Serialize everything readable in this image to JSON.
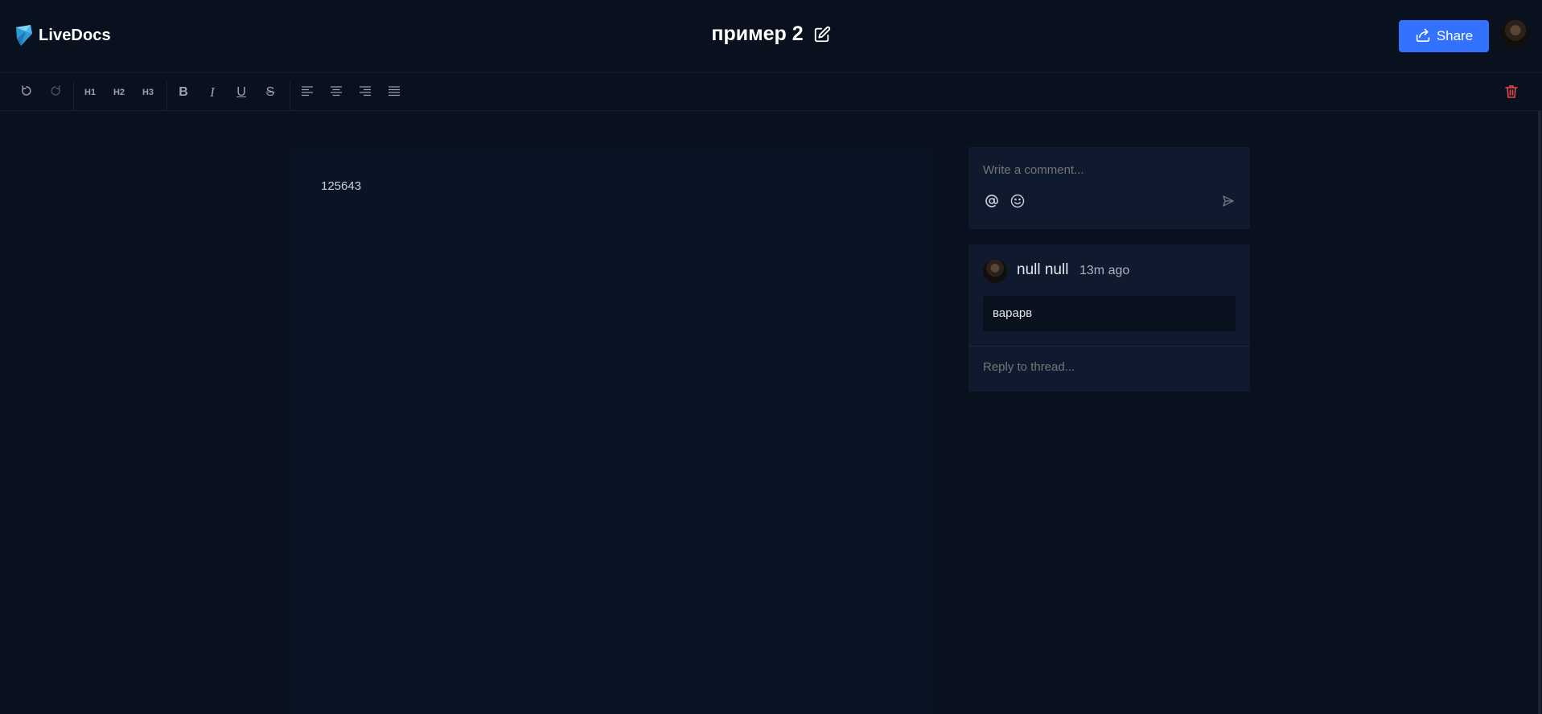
{
  "app": {
    "name": "LiveDocs"
  },
  "document": {
    "title": "пример 2",
    "content": "125643"
  },
  "header": {
    "share_label": "Share"
  },
  "comments": {
    "placeholder": "Write a comment...",
    "thread": {
      "author": "null null",
      "time": "13m ago",
      "message": "варарв",
      "reply_placeholder": "Reply to thread..."
    }
  },
  "toolbar": {
    "h1": "H1",
    "h2": "H2",
    "h3": "H3",
    "bold": "B",
    "italic": "I",
    "underline": "U",
    "strike": "S"
  },
  "colors": {
    "accent": "#3371ff",
    "danger": "#e5484d",
    "background": "#09111f",
    "panel": "#0f1a2e"
  },
  "icons": [
    "logo-icon",
    "edit-icon",
    "share-icon",
    "undo-icon",
    "redo-icon",
    "align-left-icon",
    "align-center-icon",
    "align-right-icon",
    "align-justify-icon",
    "trash-icon",
    "mention-icon",
    "emoji-icon",
    "send-icon"
  ]
}
